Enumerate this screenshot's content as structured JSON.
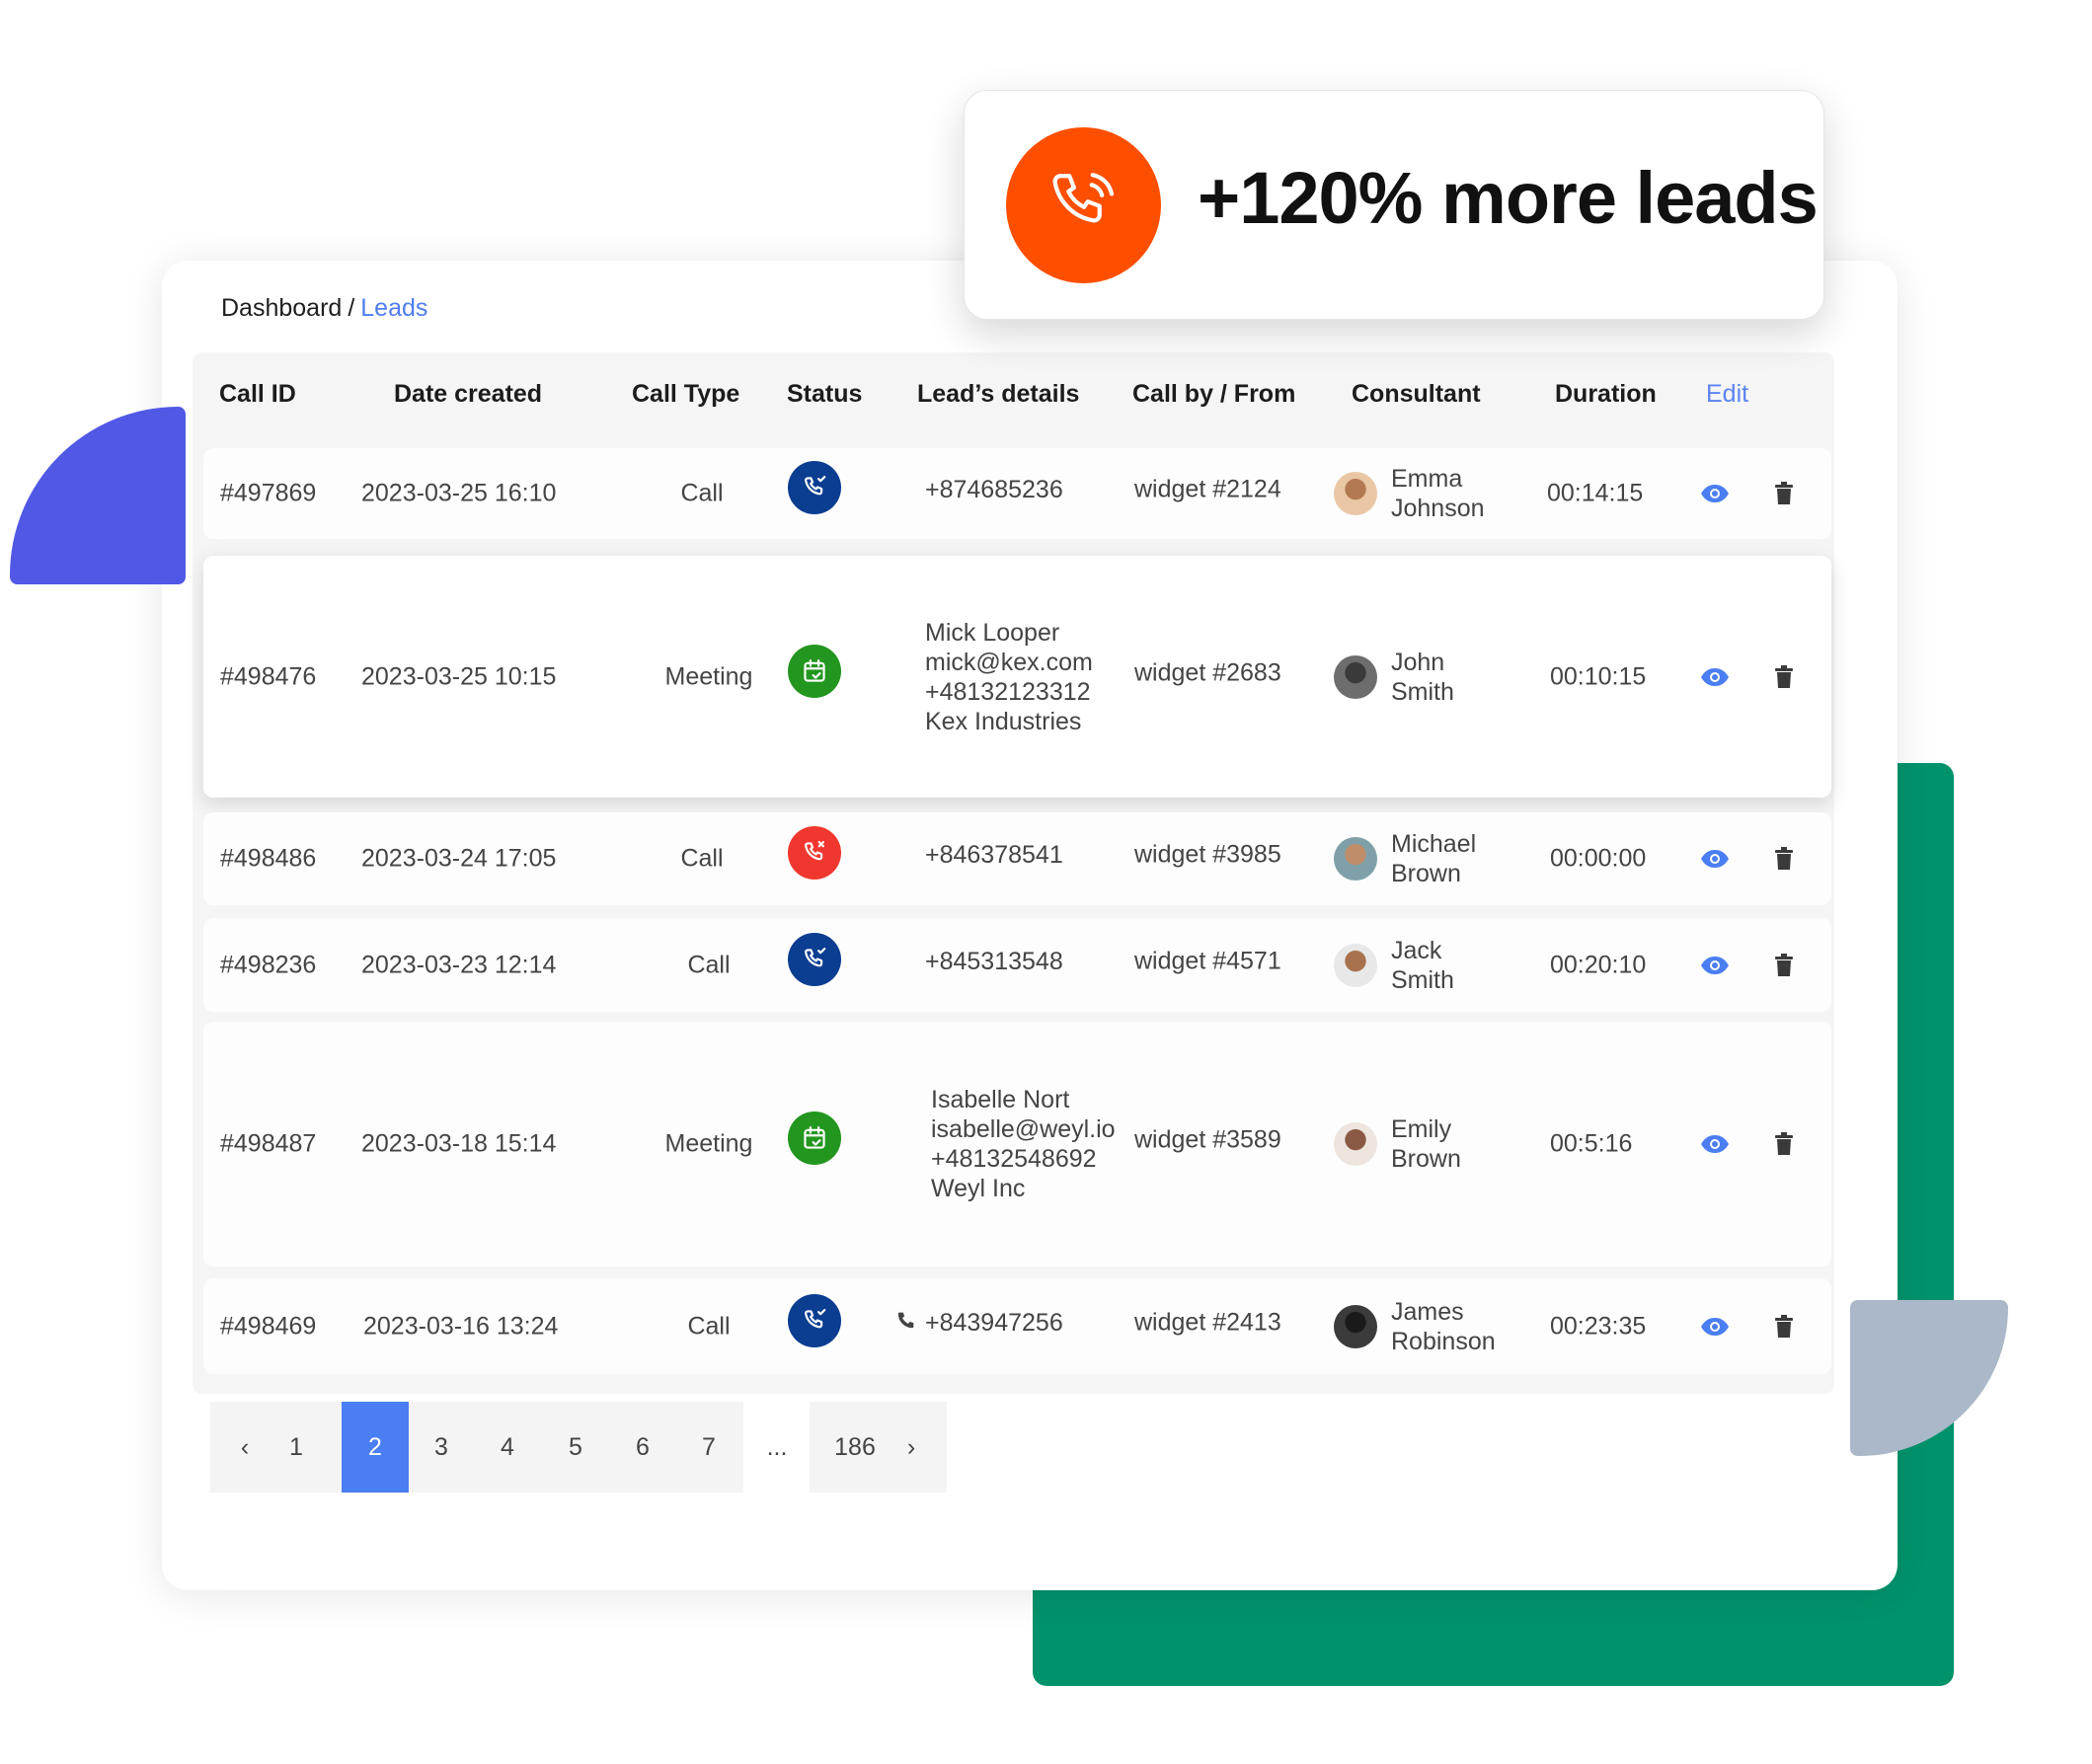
{
  "badge": {
    "icon": "phone-ringing-icon",
    "text": "+120% more leads",
    "color": "#fe4e00"
  },
  "breadcrumb": {
    "parent": "Dashboard",
    "separator": "/",
    "current": "Leads"
  },
  "table": {
    "headers": {
      "call_id": "Call ID",
      "date_created": "Date created",
      "call_type": "Call Type",
      "status": "Status",
      "lead_details": "Lead’s details",
      "call_by": "Call by / From",
      "consultant": "Consultant",
      "duration": "Duration",
      "edit": "Edit"
    },
    "rows": [
      {
        "call_id": "#497869",
        "date": "2023-03-25 16:10",
        "type": "Call",
        "status": "answered",
        "lead": [
          "+874685236"
        ],
        "from": "widget #2124",
        "consultant": [
          "Emma",
          "Johnson"
        ],
        "duration": "00:14:15"
      },
      {
        "call_id": "#498476",
        "date": "2023-03-25 10:15",
        "type": "Meeting",
        "status": "meeting",
        "lead": [
          "Mick Looper",
          "mick@kex.com",
          "+48132123312",
          "Kex Industries"
        ],
        "from": "widget #2683",
        "consultant": [
          "John",
          "Smith"
        ],
        "duration": "00:10:15"
      },
      {
        "call_id": "#498486",
        "date": "2023-03-24 17:05",
        "type": "Call",
        "status": "missed",
        "lead": [
          "+846378541"
        ],
        "from": "widget #3985",
        "consultant": [
          "Michael",
          "Brown"
        ],
        "duration": "00:00:00"
      },
      {
        "call_id": "#498236",
        "date": "2023-03-23 12:14",
        "type": "Call",
        "status": "answered",
        "lead": [
          "+845313548"
        ],
        "from": "widget #4571",
        "consultant": [
          "Jack",
          "Smith"
        ],
        "duration": "00:20:10"
      },
      {
        "call_id": "#498487",
        "date": "2023-03-18 15:14",
        "type": "Meeting",
        "status": "meeting",
        "lead": [
          "Isabelle Nort",
          "isabelle@weyl.io",
          "+48132548692",
          "Weyl Inc"
        ],
        "from": "widget #3589",
        "consultant": [
          "Emily",
          "Brown"
        ],
        "duration": "00:5:16"
      },
      {
        "call_id": "#498469",
        "date": "2023-03-16 13:24",
        "type": "Call",
        "status": "answered",
        "lead": [
          "+843947256"
        ],
        "lead_icon": "phone-icon",
        "from": "widget #2413",
        "consultant": [
          "James",
          "Robinson"
        ],
        "duration": "00:23:35"
      }
    ],
    "status_colors": {
      "answered": "#0b3d91",
      "meeting": "#23961f",
      "missed": "#f0372f"
    }
  },
  "pagination": {
    "prev": "‹",
    "next": "›",
    "pages": [
      "1",
      "2",
      "3",
      "4",
      "5",
      "6",
      "7"
    ],
    "ellipsis": "...",
    "last": "186",
    "current": "2"
  },
  "colors": {
    "accent": "#4a7ef2",
    "decor_blue": "#5158e6",
    "decor_green": "#00936b",
    "decor_grey": "#aab8c9"
  }
}
